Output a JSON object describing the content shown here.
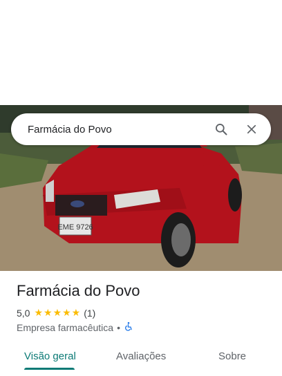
{
  "search": {
    "query": "Farmácia do Povo"
  },
  "photo": {
    "plate": "EME 9726"
  },
  "place": {
    "name": "Farmácia do Povo",
    "rating": "5,0",
    "stars": "★★★★★",
    "review_count": "(1)",
    "category": "Empresa farmacêutica",
    "separator": "•"
  },
  "tabs": [
    {
      "label": "Visão geral",
      "active": true
    },
    {
      "label": "Avaliações",
      "active": false
    },
    {
      "label": "Sobre",
      "active": false
    }
  ],
  "colors": {
    "accent": "#0b7a75",
    "star": "#fbbc04",
    "accessibility": "#1a73e8"
  },
  "icons": {
    "search": "search-icon",
    "close": "close-icon",
    "accessibility": "wheelchair-icon"
  }
}
